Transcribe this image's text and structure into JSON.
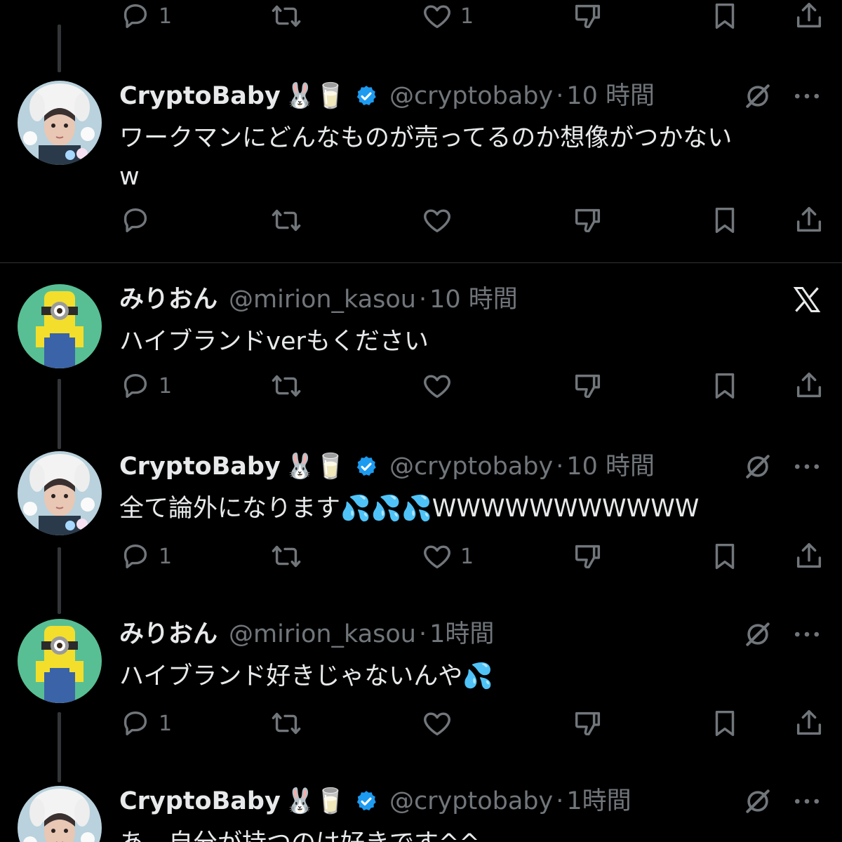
{
  "colors": {
    "background": "#000000",
    "text": "#e7e9ea",
    "muted": "#71767b",
    "verified": "#1d9bf0",
    "thread_line": "#333639"
  },
  "top_actions": {
    "reply_count": "1",
    "like_count": "1"
  },
  "tweets": [
    {
      "name": "CryptoBaby",
      "emojis": "🐰🥛",
      "verified": true,
      "handle": "@cryptobaby",
      "dot": "·",
      "time": "10 時間",
      "text": "ワークマンにどんなものが売ってるのか想像がつかない\nw",
      "reply_count": "",
      "like_count": "",
      "right_icon": "grok-icon",
      "avatar": "bunny-hat-girl-avatar"
    },
    {
      "name": "みりおん",
      "emojis": "",
      "verified": false,
      "handle": "@mirion_kasou",
      "dot": "·",
      "time": "10 時間",
      "text": "ハイブランドverもください",
      "reply_count": "1",
      "like_count": "",
      "right_icon": "x-logo-icon",
      "avatar": "pixel-minion-avatar"
    },
    {
      "name": "CryptoBaby",
      "emojis": "🐰🥛",
      "verified": true,
      "handle": "@cryptobaby",
      "dot": "·",
      "time": "10 時間",
      "text": "全て論外になります💦💦💦WWWWWWWWWWW",
      "reply_count": "1",
      "like_count": "1",
      "right_icon": "grok-icon",
      "avatar": "bunny-hat-girl-avatar"
    },
    {
      "name": "みりおん",
      "emojis": "",
      "verified": false,
      "handle": "@mirion_kasou",
      "dot": "·",
      "time": "1時間",
      "text": "ハイブランド好きじゃないんや💦",
      "reply_count": "1",
      "like_count": "",
      "right_icon": "grok-icon",
      "avatar": "pixel-minion-avatar"
    },
    {
      "name": "CryptoBaby",
      "emojis": "🐰🥛",
      "verified": true,
      "handle": "@cryptobaby",
      "dot": "·",
      "time": "1時間",
      "text": "あ、自分が持つのは好きです^^",
      "reply_count": "",
      "like_count": "",
      "right_icon": "grok-icon",
      "avatar": "bunny-hat-girl-avatar"
    }
  ]
}
